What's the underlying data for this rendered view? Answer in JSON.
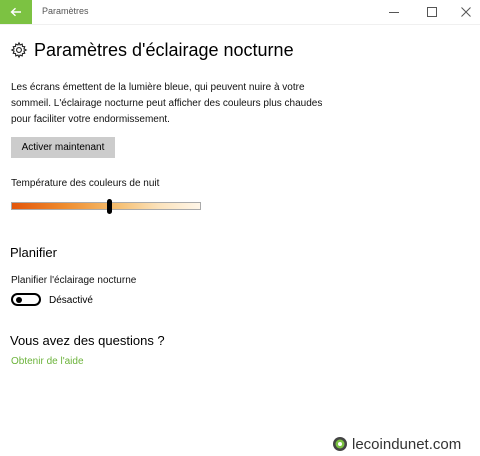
{
  "window": {
    "app_title": "Paramètres",
    "back_icon": "back-arrow-icon",
    "back_color": "#7cc242"
  },
  "header": {
    "icon": "gear-icon",
    "title": "Paramètres d'éclairage nocturne"
  },
  "main": {
    "description": "Les écrans émettent de la lumière bleue, qui peuvent nuire à votre sommeil. L'éclairage nocturne peut afficher des couleurs plus chaudes pour faciliter votre endormissement.",
    "activate_button": "Activer maintenant",
    "temperature_label": "Température des couleurs de nuit",
    "temperature_level": 0.52
  },
  "schedule": {
    "heading": "Planifier",
    "toggle_label": "Planifier l'éclairage nocturne",
    "toggle_state": "Désactivé",
    "toggle_on": false
  },
  "questions": {
    "heading": "Vous avez des questions ?",
    "help_link": "Obtenir de l'aide",
    "link_color": "#6bb33a"
  },
  "watermark": {
    "text": "lecoindunet.com"
  }
}
